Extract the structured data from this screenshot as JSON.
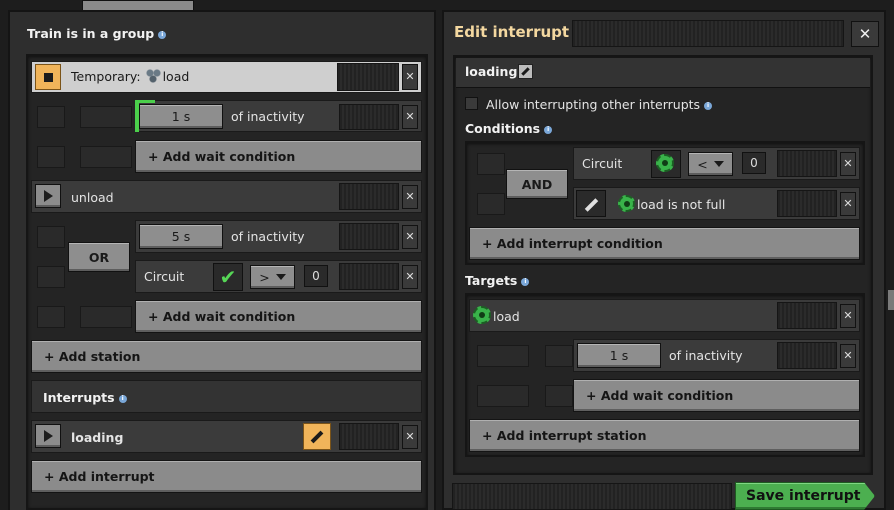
{
  "left": {
    "heading": "Train is in a group",
    "stations": [
      {
        "name_prefix": "Temporary: ",
        "name": "load"
      },
      {
        "name": "unload"
      }
    ],
    "wait1": {
      "value": "1 s",
      "label": "of inactivity",
      "add": "+ Add wait condition"
    },
    "wait2": {
      "or": "OR",
      "value": "5 s",
      "label": "of inactivity",
      "circuit": "Circuit",
      "op": ">",
      "const": "0",
      "add": "+ Add wait condition"
    },
    "add_station": "+ Add station",
    "interrupts_heading": "Interrupts",
    "interrupt": {
      "name": "loading"
    },
    "add_interrupt": "+ Add interrupt"
  },
  "right": {
    "title": "Edit interrupt",
    "close": "✕",
    "name": "loading",
    "allow_label": "Allow interrupting other interrupts",
    "conditions_heading": "Conditions",
    "and": "AND",
    "cond1": {
      "label": "Circuit",
      "op": "<",
      "const": "0"
    },
    "cond2": {
      "label": "load is not full"
    },
    "add_condition": "+ Add interrupt condition",
    "targets_heading": "Targets",
    "target": {
      "name": "load",
      "value": "1 s",
      "label": "of inactivity",
      "add": "+ Add wait condition"
    },
    "add_station": "+ Add interrupt station",
    "save": "Save interrupt"
  },
  "colors": {
    "accent": "#f0b45a",
    "save_green": "#4caf50",
    "check_green": "#56d656"
  }
}
